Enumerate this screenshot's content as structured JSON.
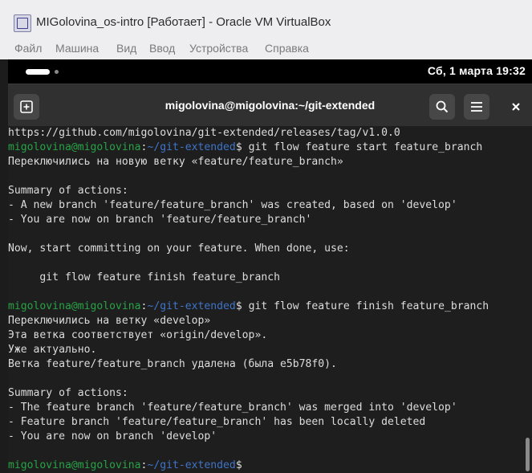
{
  "vbox": {
    "title": "MIGolovina_os-intro [Работает] - Oracle VM VirtualBox",
    "menu": [
      "Файл",
      "Машина",
      "Вид",
      "Ввод",
      "Устройства",
      "Справка"
    ]
  },
  "topbar": {
    "clock": "Сб, 1 марта  19:32"
  },
  "terminal": {
    "title": "migolovina@migolovina:~/git-extended",
    "new_tab_icon": "new-tab-icon",
    "search_icon": "search-icon",
    "menu_icon": "hamburger-icon",
    "close_icon": "close-icon",
    "prompt": {
      "user": "migolovina@migolovina",
      "sep": ":",
      "path": "~/git-extended",
      "dollar": "$"
    },
    "lines": [
      {
        "text": "https://github.com/migolovina/git-extended/releases/tag/v1.0.0"
      },
      {
        "command": " git flow feature start feature_branch"
      },
      {
        "text": "Переключились на новую ветку «feature/feature_branch»"
      },
      {
        "text": ""
      },
      {
        "text": "Summary of actions:"
      },
      {
        "text": "- A new branch 'feature/feature_branch' was created, based on 'develop'"
      },
      {
        "text": "- You are now on branch 'feature/feature_branch'"
      },
      {
        "text": ""
      },
      {
        "text": "Now, start committing on your feature. When done, use:"
      },
      {
        "text": ""
      },
      {
        "text": "     git flow feature finish feature_branch"
      },
      {
        "text": ""
      },
      {
        "command": " git flow feature finish feature_branch"
      },
      {
        "text": "Переключились на ветку «develop»"
      },
      {
        "text": "Эта ветка соответствует «origin/develop»."
      },
      {
        "text": "Уже актуально."
      },
      {
        "text": "Ветка feature/feature_branch удалена (была e5b78f0)."
      },
      {
        "text": ""
      },
      {
        "text": "Summary of actions:"
      },
      {
        "text": "- The feature branch 'feature/feature_branch' was merged into 'develop'"
      },
      {
        "text": "- Feature branch 'feature/feature_branch' has been locally deleted"
      },
      {
        "text": "- You are now on branch 'develop'"
      },
      {
        "text": ""
      },
      {
        "command": ""
      }
    ]
  },
  "colors": {
    "prompt_user": "#27a346",
    "prompt_path": "#3f74c8",
    "text": "#dddddd",
    "bg": "#1e1e1e"
  }
}
